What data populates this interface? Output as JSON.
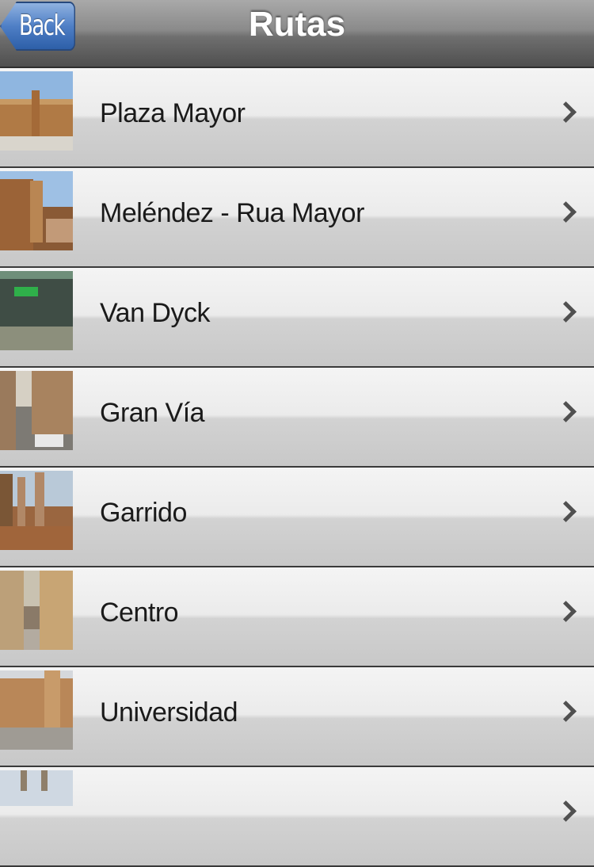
{
  "nav": {
    "back_label": "Back",
    "title": "Rutas"
  },
  "routes": [
    {
      "label": "Plaza Mayor",
      "thumb": "plaza-mayor-thumbnail"
    },
    {
      "label": "Meléndez - Rua Mayor",
      "thumb": "melendez-rua-mayor-thumbnail"
    },
    {
      "label": "Van Dyck",
      "thumb": "van-dyck-thumbnail"
    },
    {
      "label": "Gran Vía",
      "thumb": "gran-via-thumbnail"
    },
    {
      "label": "Garrido",
      "thumb": "garrido-thumbnail"
    },
    {
      "label": "Centro",
      "thumb": "centro-thumbnail"
    },
    {
      "label": "Universidad",
      "thumb": "universidad-thumbnail"
    },
    {
      "label": "",
      "thumb": "partial-row-thumbnail"
    }
  ],
  "icons": {
    "row_disclosure": "chevron-right-icon"
  },
  "colors": {
    "nav_bar": "#6f6f6f",
    "back_button": "#4f7fc6",
    "row_separator": "#3a3a3a",
    "row_label": "#1a1a1a"
  }
}
